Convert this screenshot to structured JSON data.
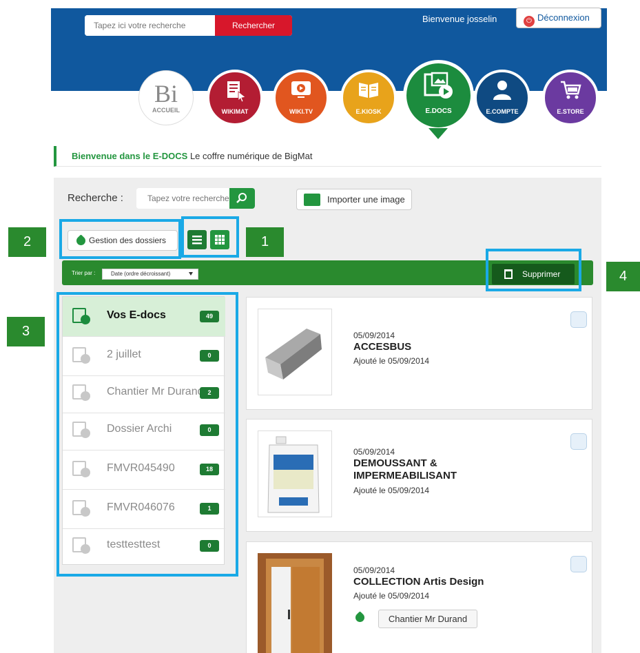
{
  "header": {
    "search": {
      "placeholder": "Tapez ici votre recherche",
      "button": "Rechercher"
    },
    "welcome": "Bienvenue josselin",
    "logout": "Déconnexion"
  },
  "nav": [
    {
      "label": "ACCUEIL",
      "logo": "Bi",
      "icon": "home-logo"
    },
    {
      "label": "WIKIMAT",
      "icon": "document-cursor-icon"
    },
    {
      "label": "WIKI.TV",
      "icon": "play-screen-icon"
    },
    {
      "label": "E.KIOSK",
      "icon": "open-book-icon"
    },
    {
      "label": "E.DOCS",
      "icon": "film-image-icon"
    },
    {
      "label": "E.COMPTE",
      "icon": "user-icon"
    },
    {
      "label": "E.STORE",
      "icon": "cart-icon"
    }
  ],
  "banner": {
    "highlight": "Bienvenue dans le E-DOCS",
    "text": " Le coffre numérique de BigMat"
  },
  "panel": {
    "search_label": "Recherche :",
    "search_placeholder": "Tapez votre recherche",
    "import_button": "Importer une image",
    "folders_button": "Gestion des dossiers",
    "sort_label": "Trier par :",
    "sort_value": "Date (ordre décroissant)",
    "delete_button": "Supprimer"
  },
  "callouts": [
    "1",
    "2",
    "3",
    "4"
  ],
  "folders": [
    {
      "name": "Vos E-docs",
      "count": "49",
      "active": true
    },
    {
      "name": "2 juillet",
      "count": "0"
    },
    {
      "name": "Chantier Mr Durand",
      "count": "2"
    },
    {
      "name": "Dossier Archi",
      "count": "0"
    },
    {
      "name": "FMVR045490",
      "count": "18"
    },
    {
      "name": "FMVR046076",
      "count": "1"
    },
    {
      "name": "testtesttest",
      "count": "0"
    }
  ],
  "documents": [
    {
      "date": "05/09/2014",
      "title": "ACCESBUS",
      "added": "Ajouté le 05/09/2014"
    },
    {
      "date": "05/09/2014",
      "title": "DEMOUSSANT & IMPERMEABILISANT",
      "added": "Ajouté le 05/09/2014"
    },
    {
      "date": "05/09/2014",
      "title": "COLLECTION Artis Design",
      "added": "Ajouté le 05/09/2014",
      "tag": "Chantier Mr Durand"
    }
  ],
  "colors": {
    "header_blue": "#10589e",
    "green": "#23963f",
    "dark_green": "#1e7b33",
    "red": "#d7172b",
    "highlight_blue": "#1aa9e6"
  }
}
